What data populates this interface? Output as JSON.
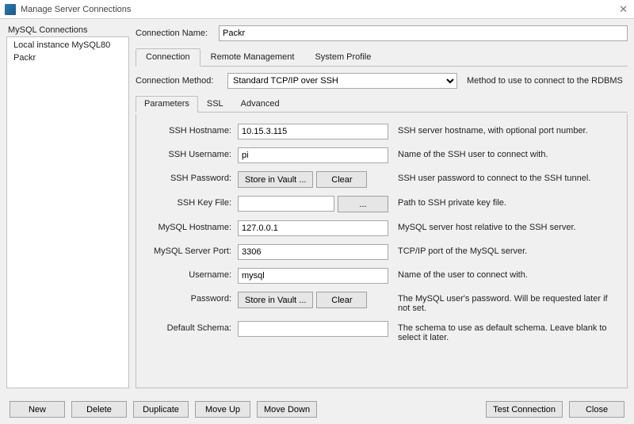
{
  "window": {
    "title": "Manage Server Connections"
  },
  "sidebar": {
    "title": "MySQL Connections",
    "items": [
      {
        "label": "Local instance MySQL80"
      },
      {
        "label": "Packr"
      }
    ]
  },
  "connection_name": {
    "label": "Connection Name:",
    "value": "Packr"
  },
  "tabs": {
    "connection": "Connection",
    "remote": "Remote Management",
    "system": "System Profile"
  },
  "method": {
    "label": "Connection Method:",
    "selected": "Standard TCP/IP over SSH",
    "hint": "Method to use to connect to the RDBMS"
  },
  "subtabs": {
    "parameters": "Parameters",
    "ssl": "SSL",
    "advanced": "Advanced"
  },
  "params": {
    "ssh_hostname": {
      "label": "SSH Hostname:",
      "value": "10.15.3.115",
      "desc": "SSH server hostname, with  optional port number."
    },
    "ssh_username": {
      "label": "SSH Username:",
      "value": "pi",
      "desc": "Name of the SSH user to connect with."
    },
    "ssh_password": {
      "label": "SSH Password:",
      "store": "Store in Vault ...",
      "clear": "Clear",
      "desc": "SSH user password to connect to the SSH tunnel."
    },
    "ssh_keyfile": {
      "label": "SSH Key File:",
      "value": "",
      "browse": "...",
      "desc": "Path to SSH private key file."
    },
    "mysql_hostname": {
      "label": "MySQL Hostname:",
      "value": "127.0.0.1",
      "desc": "MySQL server host relative to the SSH server."
    },
    "mysql_port": {
      "label": "MySQL Server Port:",
      "value": "3306",
      "desc": "TCP/IP port of the MySQL server."
    },
    "username": {
      "label": "Username:",
      "value": "mysql",
      "desc": "Name of the user to connect with."
    },
    "password": {
      "label": "Password:",
      "store": "Store in Vault ...",
      "clear": "Clear",
      "desc": "The MySQL user's password. Will be requested later if not set."
    },
    "default_schema": {
      "label": "Default Schema:",
      "value": "",
      "desc": "The schema to use as default schema. Leave blank to select it later."
    }
  },
  "footer": {
    "new": "New",
    "delete": "Delete",
    "duplicate": "Duplicate",
    "move_up": "Move Up",
    "move_down": "Move Down",
    "test": "Test Connection",
    "close": "Close"
  }
}
